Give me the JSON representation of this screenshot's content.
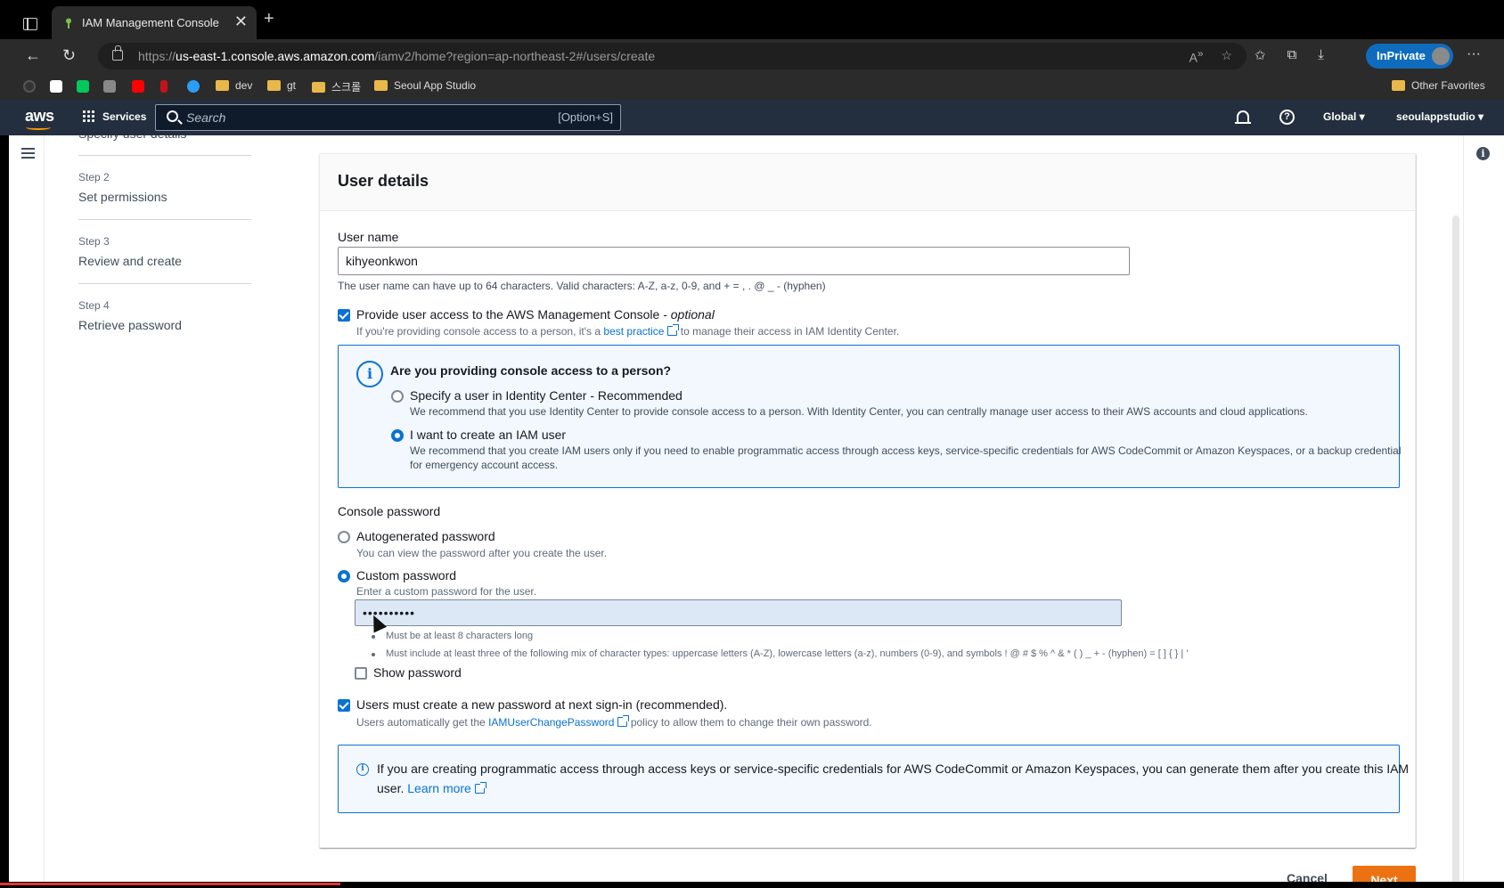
{
  "browser": {
    "tab_title": "IAM Management Console",
    "tab_close": "✕",
    "new_tab": "+",
    "url_prefix": "https://",
    "url_host": "us-east-1.console.aws.amazon.com",
    "url_path": "/iamv2/home?region=ap-northeast-2#/users/create",
    "inprivate_label": "InPrivate",
    "bookmarks": [
      "dev",
      "gt",
      "스크롤",
      "Seoul App Studio"
    ],
    "other_favorites": "Other Favorites"
  },
  "aws_header": {
    "logo": "aws",
    "services_label": "Services",
    "search_placeholder": "Search",
    "search_shortcut": "[Option+S]",
    "region_label": "Global",
    "account_label": "seoulappstudio"
  },
  "steps": {
    "cut_label": "Specify user details",
    "items": [
      {
        "number": "Step 2",
        "label": "Set permissions"
      },
      {
        "number": "Step 3",
        "label": "Review and create"
      },
      {
        "number": "Step 4",
        "label": "Retrieve password"
      }
    ]
  },
  "form": {
    "panel_title": "User details",
    "username_label": "User name",
    "username_value": "kihyeonkwon",
    "username_hint": "The user name can have up to 64 characters. Valid characters: A-Z, a-z, 0-9, and + = , . @ _ - (hyphen)",
    "console_access_label": "Provide user access to the AWS Management Console - ",
    "console_access_optional": "optional",
    "console_access_desc_pre": "If you're providing console access to a person, it's a ",
    "console_access_link": "best practice",
    "console_access_desc_post": " to manage their access in IAM Identity Center.",
    "person_question": "Are you providing console access to a person?",
    "option_identity_center": "Specify a user in Identity Center - Recommended",
    "option_identity_center_desc": "We recommend that you use Identity Center to provide console access to a person. With Identity Center, you can centrally manage user access to their AWS accounts and cloud applications.",
    "option_iam_user": "I want to create an IAM user",
    "option_iam_user_desc_1": "We recommend that you create IAM users only if you need to enable programmatic access through access keys, service-specific credentials for AWS CodeCommit or Amazon Keyspaces, or a backup credential",
    "option_iam_user_desc_2": "for emergency account access.",
    "password_section_label": "Console password",
    "autogen_label": "Autogenerated password",
    "autogen_desc": "You can view the password after you create the user.",
    "custom_label": "Custom password",
    "custom_desc": "Enter a custom password for the user.",
    "password_value": "••••••••••",
    "rule_1": "Must be at least 8 characters long",
    "rule_2": "Must include at least three of the following mix of character types: uppercase letters (A-Z), lowercase letters (a-z), numbers (0-9), and symbols ! @ # $ % ^ & * ( ) _ + - (hyphen) = [ ] { } | '",
    "show_password_label": "Show password",
    "reset_label": "Users must create a new password at next sign-in (recommended).",
    "reset_desc_pre": "Users automatically get the ",
    "reset_desc_link": "IAMUserChangePassword",
    "reset_desc_post": " policy to allow them to change their own password.",
    "bottom_info_1": "If you are creating programmatic access through access keys or service-specific credentials for AWS CodeCommit or Amazon Keyspaces, you can generate them after you create this IAM",
    "bottom_info_2_pre": "user. ",
    "bottom_info_link": "Learn more"
  },
  "actions": {
    "cancel": "Cancel",
    "next": "Next"
  },
  "colors": {
    "aws_header": "#232f3e",
    "primary_blue": "#0972d3",
    "next_orange": "#ec7211"
  }
}
